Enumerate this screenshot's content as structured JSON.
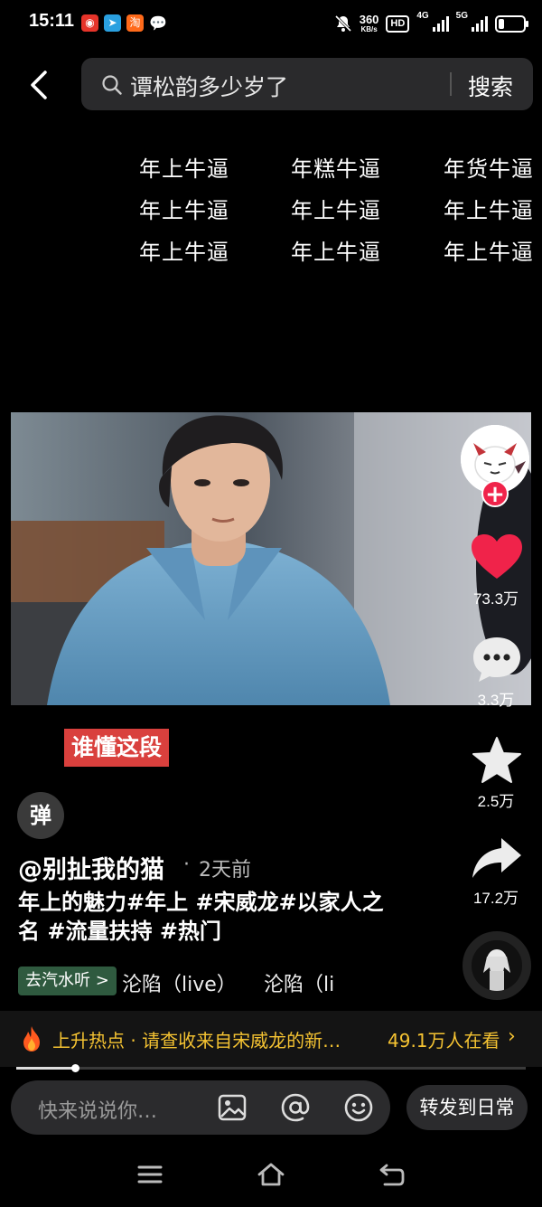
{
  "status_bar": {
    "time": "15:11",
    "speed_value": "360",
    "speed_unit": "KB/s",
    "hd_label": "HD",
    "net1_label": "4G",
    "net2_label": "5G",
    "app_icons": [
      "weibo-icon",
      "telegram-icon",
      "taobao-icon",
      "wechat-icon"
    ]
  },
  "search": {
    "query": "谭松韵多少岁了",
    "button_label": "搜索"
  },
  "text_grid": [
    [
      "年上牛逼",
      "年糕牛逼",
      "年货牛逼"
    ],
    [
      "年上牛逼",
      "年上牛逼",
      "年上牛逼"
    ],
    [
      "年上牛逼",
      "年上牛逼",
      "年上牛逼"
    ]
  ],
  "video": {
    "caption_tag": "谁懂这段",
    "danmu_label": "弹"
  },
  "post": {
    "author": "@别扯我的猫",
    "time_ago": "2天前",
    "description_line1": "年上的魅力#年上 #宋威龙#以家人之",
    "description_line2": "名 #流量扶持 #热门",
    "music_tag": "去汽水听 >",
    "music_title_1": "沦陷（live）",
    "music_title_2": "沦陷（li"
  },
  "actions": {
    "likes": "73.3万",
    "comments": "3.3万",
    "favorites": "2.5万",
    "shares": "17.2万"
  },
  "hot_bar": {
    "text": "上升热点 · 请查收来自宋威龙的新…",
    "watchers": "49.1万人在看",
    "chevron": "›"
  },
  "playback_progress": 0.115,
  "comment_bar": {
    "placeholder": "快来说说你…",
    "forward_label": "转发到日常"
  },
  "colors": {
    "like_red": "#f0234a",
    "hot_yellow": "#f5c332",
    "caption_red": "#d9403d",
    "music_tag_green": "#2f5a3f"
  }
}
